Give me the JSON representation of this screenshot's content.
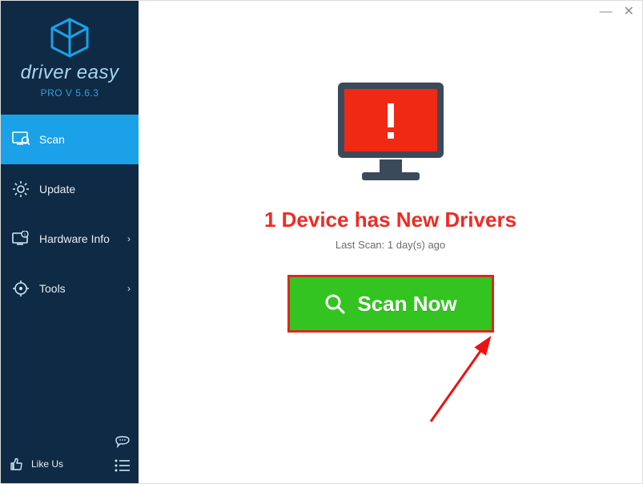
{
  "brand": "driver easy",
  "version": "PRO V 5.6.3",
  "sidebar": {
    "items": [
      {
        "label": "Scan"
      },
      {
        "label": "Update"
      },
      {
        "label": "Hardware Info"
      },
      {
        "label": "Tools"
      }
    ],
    "like_us": "Like Us"
  },
  "main": {
    "headline": "1 Device has New Drivers",
    "last_scan": "Last Scan: 1 day(s) ago",
    "scan_button": "Scan Now"
  },
  "colors": {
    "accent": "#1aa1e8",
    "danger": "#ee2b24",
    "success": "#34c421",
    "sidebar_bg": "#0f2a44"
  }
}
